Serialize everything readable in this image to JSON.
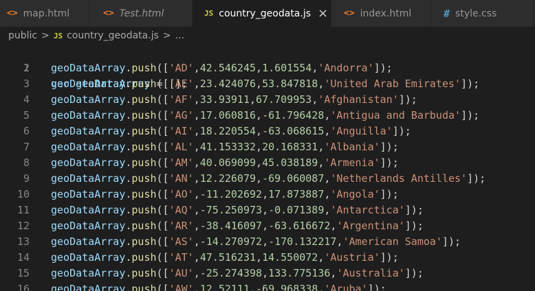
{
  "tabs": [
    {
      "label": "map.html",
      "icon": "html-icon",
      "icon_glyph": "<>",
      "active": false,
      "italic": false
    },
    {
      "label": "Test.html",
      "icon": "html-icon",
      "icon_glyph": "<>",
      "active": false,
      "italic": true
    },
    {
      "label": "country_geodata.js",
      "icon": "js-icon",
      "icon_glyph": "JS",
      "active": true,
      "italic": false,
      "close": "×"
    },
    {
      "label": "index.html",
      "icon": "html-icon",
      "icon_glyph": "<>",
      "active": false,
      "italic": false
    },
    {
      "label": "style.css",
      "icon": "css-icon",
      "icon_glyph": "#",
      "active": false,
      "italic": false
    }
  ],
  "breadcrumb": {
    "folder": "public",
    "separator": ">",
    "file_icon": "JS",
    "file": "country_geodata.js",
    "ellipsis": "..."
  },
  "code": {
    "declaration": {
      "keyword": "var",
      "name": "geoDataArray",
      "rest": " = [];"
    },
    "call_object": "geoDataArray",
    "call_method": "push",
    "rows": [
      {
        "code": "'AD'",
        "lat": "42.546245",
        "lng": "1.601554",
        "name": "'Andorra'"
      },
      {
        "code": "'AE'",
        "lat": "23.424076",
        "lng": "53.847818",
        "name": "'United Arab Emirates'"
      },
      {
        "code": "'AF'",
        "lat": "33.93911",
        "lng": "67.709953",
        "name": "'Afghanistan'"
      },
      {
        "code": "'AG'",
        "lat": "17.060816",
        "lng": "-61.796428",
        "name": "'Antigua and Barbuda'"
      },
      {
        "code": "'AI'",
        "lat": "18.220554",
        "lng": "-63.068615",
        "name": "'Anguilla'"
      },
      {
        "code": "'AL'",
        "lat": "41.153332",
        "lng": "20.168331",
        "name": "'Albania'"
      },
      {
        "code": "'AM'",
        "lat": "40.069099",
        "lng": "45.038189",
        "name": "'Armenia'"
      },
      {
        "code": "'AN'",
        "lat": "12.226079",
        "lng": "-69.060087",
        "name": "'Netherlands Antilles'"
      },
      {
        "code": "'AO'",
        "lat": "-11.202692",
        "lng": "17.873887",
        "name": "'Angola'"
      },
      {
        "code": "'AQ'",
        "lat": "-75.250973",
        "lng": "-0.071389",
        "name": "'Antarctica'"
      },
      {
        "code": "'AR'",
        "lat": "-38.416097",
        "lng": "-63.616672",
        "name": "'Argentina'"
      },
      {
        "code": "'AS'",
        "lat": "-14.270972",
        "lng": "-170.132217",
        "name": "'American Samoa'"
      },
      {
        "code": "'AT'",
        "lat": "47.516231",
        "lng": "14.550072",
        "name": "'Austria'"
      },
      {
        "code": "'AU'",
        "lat": "-25.274398",
        "lng": "133.775136",
        "name": "'Australia'"
      },
      {
        "code": "'AW'",
        "lat": "12.52111",
        "lng": "-69.968338",
        "name": "'Aruba'"
      }
    ]
  },
  "colors": {
    "editor_bg": "#1e1e1e",
    "tab_inactive_bg": "#2d2d2d",
    "keyword": "#569cd6",
    "variable": "#9cdcfe",
    "function": "#dcdcaa",
    "string": "#ce9178",
    "number": "#b5cea8",
    "line_number": "#858585"
  }
}
